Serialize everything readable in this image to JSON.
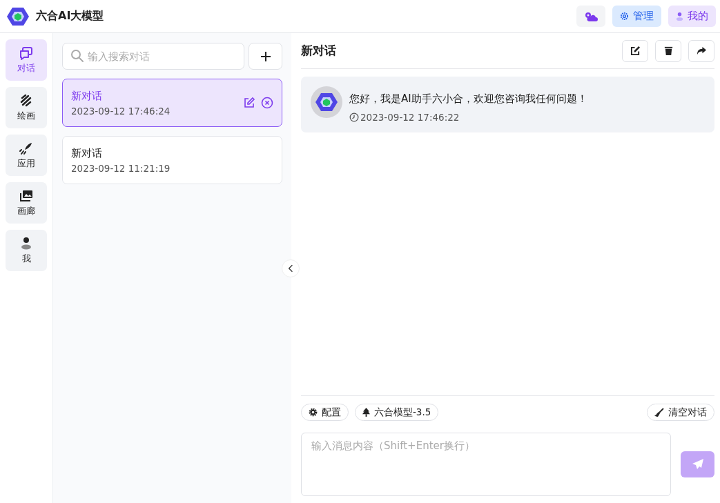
{
  "header": {
    "title": "六合AI大模型",
    "buttons": [
      {
        "kind": "theme"
      },
      {
        "kind": "admin",
        "label": "管理"
      },
      {
        "kind": "mine",
        "label": "我的"
      }
    ]
  },
  "nav": [
    {
      "kind": "chat",
      "label": "对话",
      "selected": true
    },
    {
      "kind": "draw",
      "label": "绘画",
      "selected": false
    },
    {
      "kind": "apps",
      "label": "应用",
      "selected": false
    },
    {
      "kind": "gallery",
      "label": "画廊",
      "selected": false
    },
    {
      "kind": "me",
      "label": "我",
      "selected": false
    }
  ],
  "search": {
    "placeholder": "输入搜索对话"
  },
  "conversations": [
    {
      "title": "新对话",
      "time": "2023-09-12 17:46:24",
      "selected": true
    },
    {
      "title": "新对话",
      "time": "2023-09-12 11:21:19",
      "selected": false
    }
  ],
  "chat": {
    "title": "新对话",
    "messages": [
      {
        "text": "您好，我是AI助手六小合，欢迎您咨询我任何问题！",
        "time": "2023-09-12 17:46:22"
      }
    ],
    "chips": [
      {
        "kind": "settings",
        "label": "配置"
      },
      {
        "kind": "model",
        "label": "六合模型-3.5"
      }
    ],
    "clear_label": "清空对话",
    "input": {
      "placeholder": "输入消息内容（Shift+Enter换行）"
    }
  }
}
